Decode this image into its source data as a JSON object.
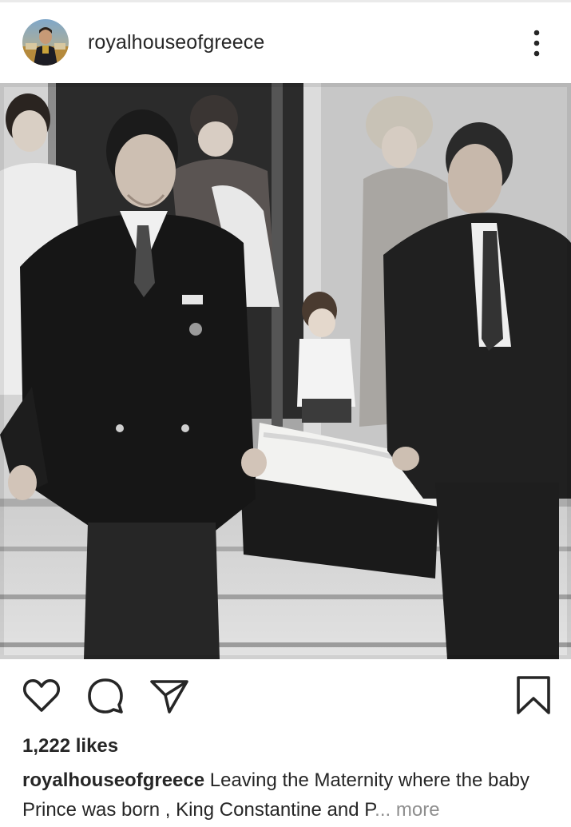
{
  "header": {
    "username": "royalhouseofgreece",
    "avatar_icon": "avatar-photo",
    "menu_icon": "more-vertical-icon"
  },
  "post": {
    "photo_description": "black-and-white-photo",
    "likes": "1,222 likes",
    "caption_user": "royalhouseofgreece",
    "caption_text": "Leaving the Maternity where the baby Prince was born , King Constantine and P",
    "caption_ellipsis": "...",
    "more_label": "more"
  },
  "actions": {
    "like_icon": "heart-icon",
    "comment_icon": "comment-icon",
    "share_icon": "send-icon",
    "save_icon": "bookmark-icon"
  },
  "colors": {
    "text": "#262626",
    "muted": "#8e8e8e",
    "divider": "#eaeaea"
  }
}
